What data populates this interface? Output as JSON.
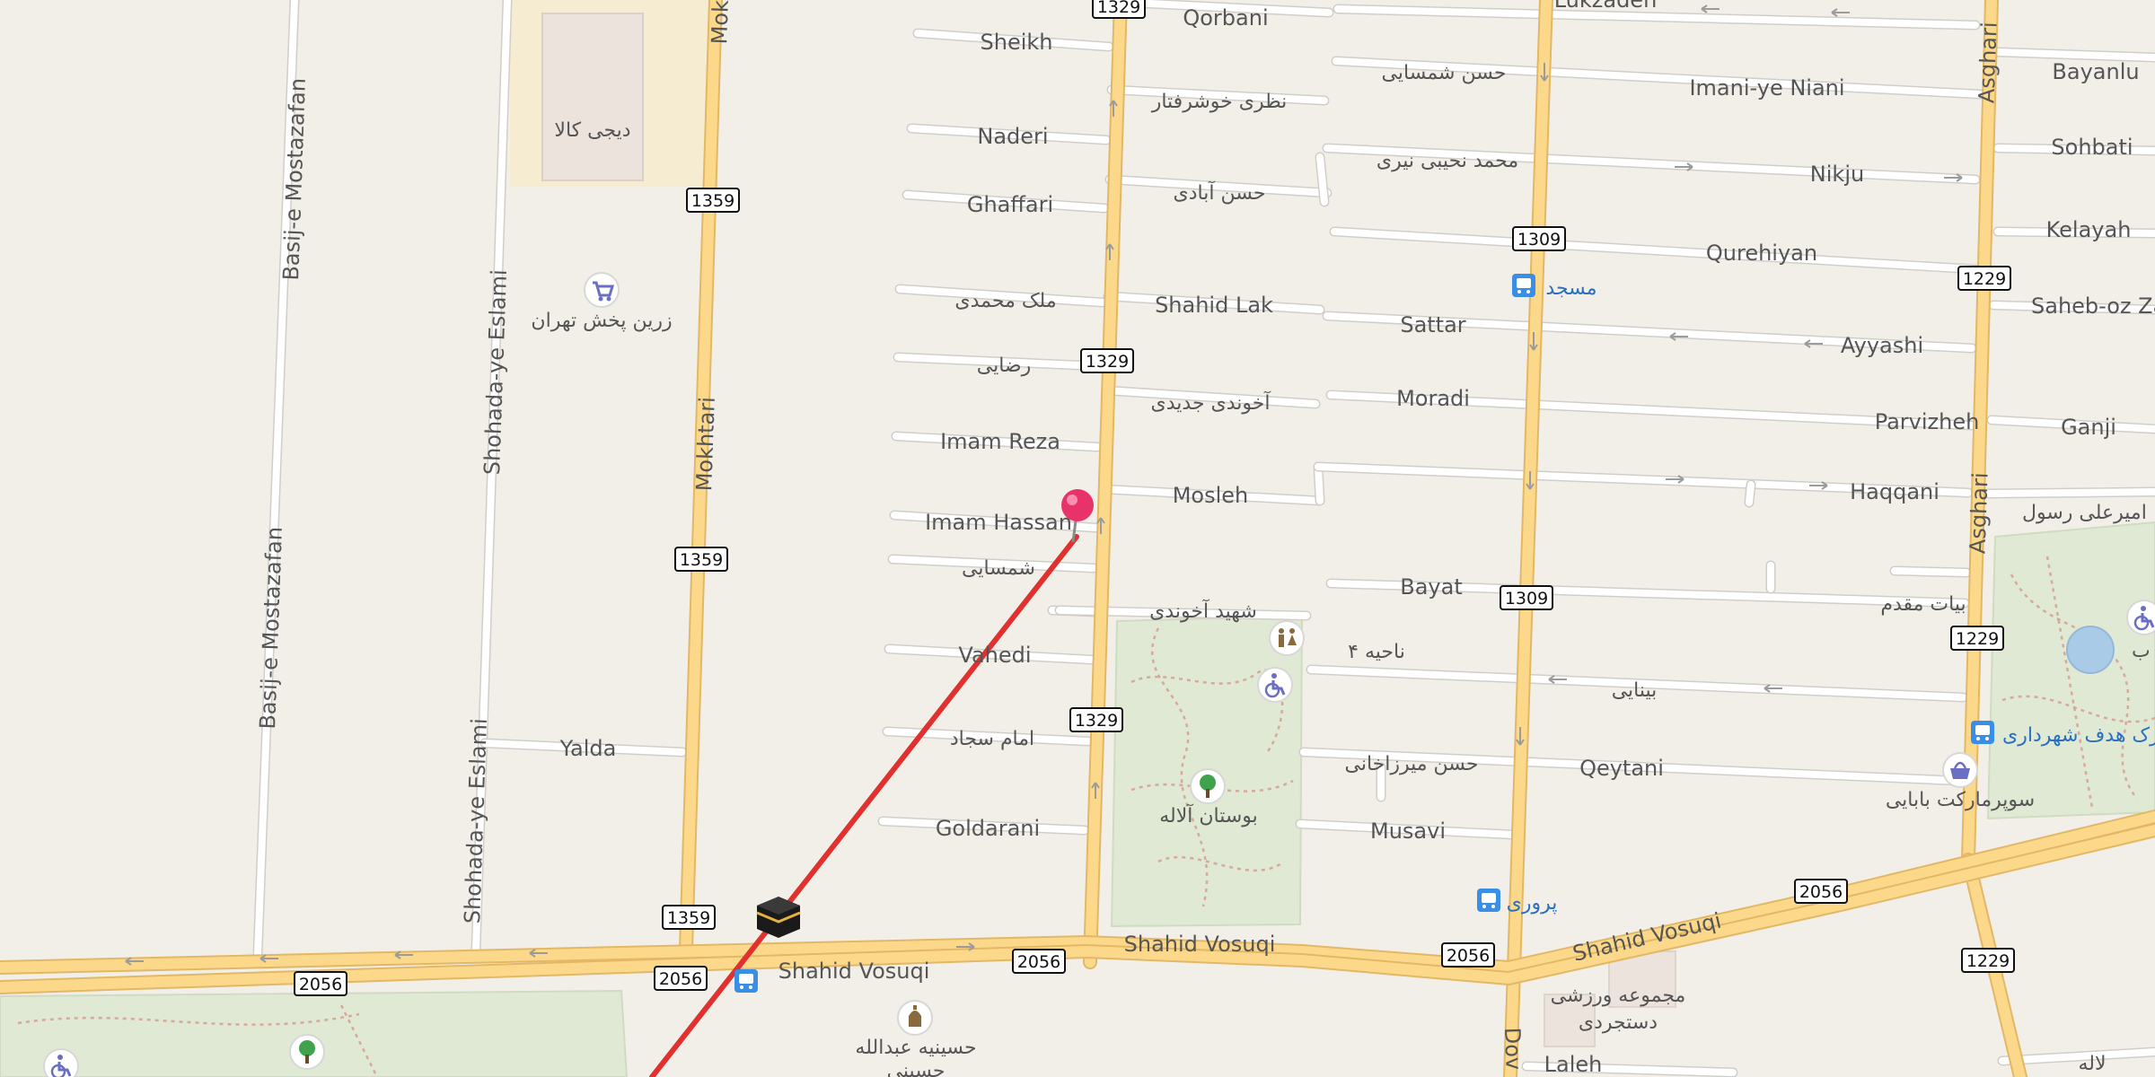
{
  "map": {
    "colors": {
      "background": "#f2efe9",
      "major_road": "#fcd98a",
      "minor_road": "#ffffff",
      "park": "#dfe9d3",
      "route_line": "#e0312f",
      "marker": "#e8336a",
      "poi_icon": "#6a6fc3",
      "transit_icon": "#3a8ee6"
    },
    "streets": {
      "basij1": "Basij-e Mostazafan",
      "basij2": "Basij-e Mostazafan",
      "shohada1": "Shohada-ye Eslami",
      "shohada2": "Shohada-ye Eslami",
      "mokhtari_top": "Mok",
      "mokhtari": "Mokhtari",
      "yalda": "Yalda",
      "qorbani": "Qorbani",
      "sheikh": "Sheikh",
      "naderi": "Naderi",
      "ghaffari": "Ghaffari",
      "malek": "ملک محمدی",
      "rezaei": "رضایی",
      "imam_reza": "Imam Reza",
      "imam_hassan": "Imam Hassan",
      "shamsaei": "شمسایی",
      "vahedi": "Vahedi",
      "imam_sajjad": "امام سجاد",
      "goldarani": "Goldarani",
      "nazari": "نظری خوشرفتار",
      "hasanabadi": "حسن آبادی",
      "shahid_lak": "Shahid Lak",
      "akhundi_jadidi": "آخوندی جدیدی",
      "mosleh": "Mosleh",
      "shahid_akhundi": "شهید آخوندی",
      "lukzadeh": "Lukzadeh",
      "hasan_shamsaei": "حسن شمسایی",
      "imani": "Imani-ye Niani",
      "mohammad_nahib": "محمد نحیبی نیری",
      "nikju": "Nikju",
      "qurehiyan": "Qurehiyan",
      "sattar": "Sattar",
      "ayyashi": "Ayyashi",
      "moradi": "Moradi",
      "parvizheh": "Parvizheh",
      "haqqani": "Haqqani",
      "bayat": "Bayat",
      "bayat_moqaddam": "بیات مقدم",
      "binaei": "بینایی",
      "hasan_mirzakhani": "حسن میرزاخانی",
      "qeytani": "Qeytani",
      "musavi": "Musavi",
      "shahid_vosuqi_1": "Shahid Vosuqi",
      "shahid_vosuqi_2": "Shahid Vosuqi",
      "shahid_vosuqi_3": "Shahid Vosuqi",
      "dov": "Dov",
      "laleh": "Laleh",
      "laleh_fa": "لاله",
      "asghari_1": "Asghari",
      "asghari_2": "Asghari",
      "bayanlu": "Bayanlu",
      "sohbati": "Sohbati",
      "kelayah": "Kelayah",
      "saheb": "Saheb-oz Za",
      "ganji": "Ganji",
      "amir_ali": "امیرعلی رسول"
    },
    "road_shields": [
      "1329",
      "1359",
      "1359",
      "1359",
      "1329",
      "1329",
      "1309",
      "1309",
      "1229",
      "1229",
      "1229",
      "2056",
      "2056",
      "2056",
      "2056",
      "2056"
    ],
    "pois": {
      "digikala": "دیجی کالا",
      "zarrin": "زرین پخش تهران",
      "masjed": "مسجد",
      "naheyeh": "ناحیه ۴",
      "bustan": "بوستان آلاله",
      "park_hadaf": "پارک هدف شهرداری",
      "supermarket": "سوپرمارکت بابایی",
      "parvari": "پروری",
      "majmoeh_1": "مجموعه ورزشی",
      "majmoeh_2": "دستجردی",
      "hosseiniyeh_1": "حسینیه عبدالله",
      "hosseiniyeh_2": "حسینی",
      "zamin": "زمین ب"
    },
    "icons": {
      "cart": "shopping-cart-icon",
      "bus": "bus-stop-icon",
      "toilet": "toilets-icon",
      "wheelchair": "wheelchair-icon",
      "tree": "tree-icon",
      "basket": "basket-icon",
      "kaaba": "kaaba-icon",
      "hosseiniyeh": "hosseiniyeh-icon",
      "pin": "map-pin-icon"
    }
  }
}
